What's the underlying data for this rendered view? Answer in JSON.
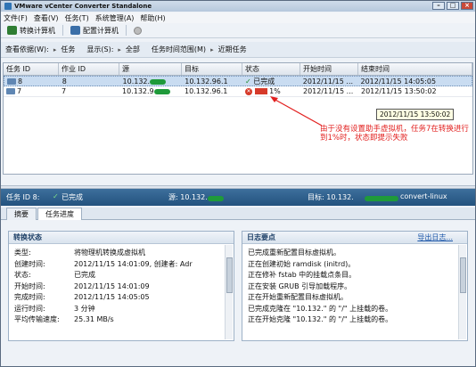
{
  "window": {
    "title": "VMware vCenter Converter Standalone"
  },
  "menu": [
    "文件(F)",
    "查看(V)",
    "任务(T)",
    "系统管理(A)",
    "帮助(H)"
  ],
  "toolbar": {
    "convert_label": "转换计算机",
    "configure_label": "配置计算机"
  },
  "filter": {
    "view_by_label": "查看依据(W):",
    "view_by_value": "任务",
    "show_label": "显示(S):",
    "show_value": "全部",
    "range_label": "任务时间范围(M)",
    "range_value": "近期任务"
  },
  "grid": {
    "columns": [
      "任务 ID",
      "作业 ID",
      "源",
      "目标",
      "状态",
      "开始时间",
      "结束时间"
    ],
    "rows": [
      {
        "task_id": "8",
        "job_id": "8",
        "source": "10.132.",
        "target": "10.132.96.1",
        "status": "已完成",
        "start": "2012/11/15 ...",
        "end": "2012/11/15 14:05:05"
      },
      {
        "task_id": "7",
        "job_id": "7",
        "source": "10.132.9",
        "target": "10.132.96.1",
        "status": "1%",
        "start": "2012/11/15 ...",
        "end": "2012/11/15 13:50:02"
      }
    ]
  },
  "tooltip": "2012/11/15 13:50:02",
  "annotation": "由于没有设置助手虚拟机，任务7在转换进行到1%时，状态即提示失败",
  "detail": {
    "task_label": "任务 ID 8:",
    "task_status": "已完成",
    "source_label": "源: 10.132.",
    "target_label": "目标: 10.132.",
    "target_suffix": "convert-linux"
  },
  "tabs": [
    "摘要",
    "任务进度"
  ],
  "conversion_panel": {
    "title": "转换状态",
    "fields": [
      {
        "key": "类型:",
        "value": "将物理机转换成虚拟机"
      },
      {
        "key": "创建时间:",
        "value": "2012/11/15 14:01:09, 创建者: Adr"
      },
      {
        "key": "状态:",
        "value": "已完成"
      },
      {
        "key": "开始时间:",
        "value": "2012/11/15 14:01:09"
      },
      {
        "key": "完成时间:",
        "value": "2012/11/15 14:05:05"
      },
      {
        "key": "运行时间:",
        "value": "3 分钟"
      },
      {
        "key": "平均传输速度:",
        "value": "25.31 MB/s"
      }
    ]
  },
  "log_panel": {
    "title": "日志要点",
    "export_link": "导出日志...",
    "lines": [
      "已完成重新配置目标虚拟机。",
      "正在创建初始 ramdisk (initrd)。",
      "正在修补 fstab 中的挂载点条目。",
      "正在安装 GRUB 引导加载程序。",
      "正在开始重新配置目标虚拟机。",
      "已完成克隆在 \"10.132.\" 的 \"/\" 上挂载的卷。",
      "正在开始克隆 \"10.132.\" 的 \"/\" 上挂载的卷。"
    ]
  },
  "colors": {
    "accent": "#2f5f8f",
    "annotation": "#e2201f",
    "success": "#1c8c2c",
    "error": "#d63a2a"
  }
}
